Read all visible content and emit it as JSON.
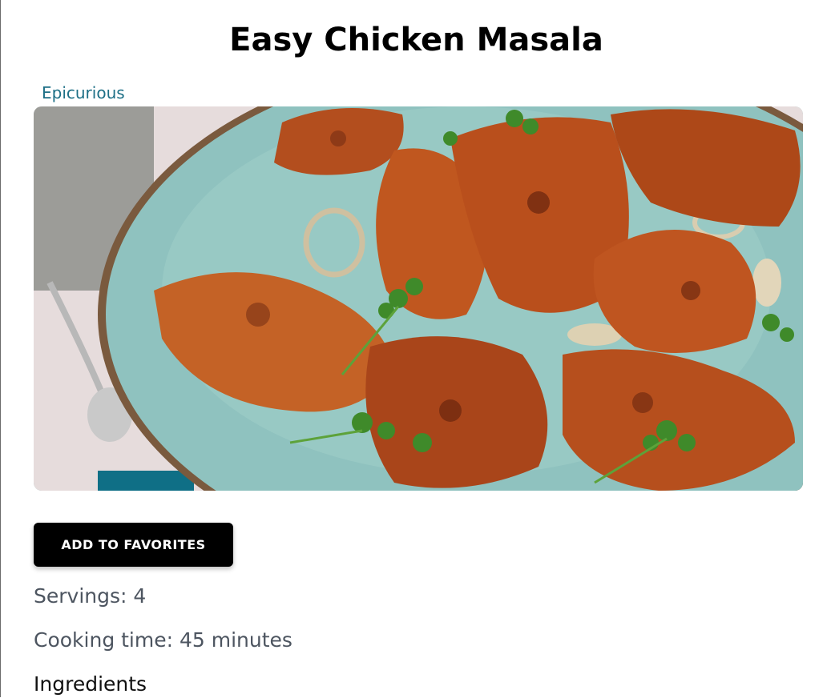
{
  "recipe": {
    "title": "Easy Chicken Masala",
    "source": "Epicurious",
    "image_alt": "Roasted chicken masala pieces with onions and cilantro on a turquoise ceramic platter",
    "favorite_button_label": "ADD TO FAVORITES",
    "servings_text": "Servings: 4",
    "cooking_time_text": "Cooking time: 45 minutes",
    "ingredients_heading": "Ingredients"
  },
  "colors": {
    "source_link": "#1d6f86",
    "button_bg": "#000000",
    "meta_text": "#4d5560"
  }
}
